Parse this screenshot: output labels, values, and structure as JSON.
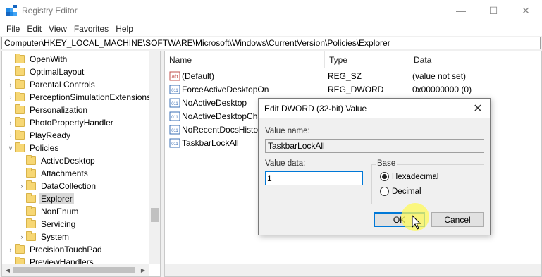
{
  "window": {
    "title": "Registry Editor"
  },
  "menu": [
    "File",
    "Edit",
    "View",
    "Favorites",
    "Help"
  ],
  "address": "Computer\\HKEY_LOCAL_MACHINE\\SOFTWARE\\Microsoft\\Windows\\CurrentVersion\\Policies\\Explorer",
  "tree": {
    "items": [
      {
        "label": "OpenWith",
        "expandable": false,
        "level": 0
      },
      {
        "label": "OptimalLayout",
        "expandable": false,
        "level": 0
      },
      {
        "label": "Parental Controls",
        "expandable": true,
        "level": 0
      },
      {
        "label": "PerceptionSimulationExtensions",
        "expandable": true,
        "level": 0
      },
      {
        "label": "Personalization",
        "expandable": false,
        "level": 0
      },
      {
        "label": "PhotoPropertyHandler",
        "expandable": true,
        "level": 0
      },
      {
        "label": "PlayReady",
        "expandable": true,
        "level": 0
      },
      {
        "label": "Policies",
        "expandable": true,
        "expanded": true,
        "level": 0
      },
      {
        "label": "ActiveDesktop",
        "expandable": false,
        "level": 1
      },
      {
        "label": "Attachments",
        "expandable": false,
        "level": 1
      },
      {
        "label": "DataCollection",
        "expandable": true,
        "level": 1
      },
      {
        "label": "Explorer",
        "expandable": false,
        "level": 1,
        "selected": true
      },
      {
        "label": "NonEnum",
        "expandable": false,
        "level": 1
      },
      {
        "label": "Servicing",
        "expandable": false,
        "level": 1
      },
      {
        "label": "System",
        "expandable": true,
        "level": 1
      },
      {
        "label": "PrecisionTouchPad",
        "expandable": true,
        "level": 0
      },
      {
        "label": "PreviewHandlers",
        "expandable": false,
        "level": 0
      }
    ]
  },
  "list": {
    "columns": [
      "Name",
      "Type",
      "Data"
    ],
    "rows": [
      {
        "icon": "string-value-icon",
        "name": "(Default)",
        "type": "REG_SZ",
        "data": "(value not set)"
      },
      {
        "icon": "dword-value-icon",
        "name": "ForceActiveDesktopOn",
        "type": "REG_DWORD",
        "data": "0x00000000 (0)"
      },
      {
        "icon": "dword-value-icon",
        "name": "NoActiveDesktop",
        "type": "",
        "data": ""
      },
      {
        "icon": "dword-value-icon",
        "name": "NoActiveDesktopCha",
        "type": "",
        "data": ""
      },
      {
        "icon": "dword-value-icon",
        "name": "NoRecentDocsHistor",
        "type": "",
        "data": ""
      },
      {
        "icon": "dword-value-icon",
        "name": "TaskbarLockAll",
        "type": "",
        "data": ""
      }
    ]
  },
  "dialog": {
    "title": "Edit DWORD (32-bit) Value",
    "value_name_label": "Value name:",
    "value_name": "TaskbarLockAll",
    "value_data_label": "Value data:",
    "value_data": "1",
    "base_label": "Base",
    "hex_label": "Hexadecimal",
    "dec_label": "Decimal",
    "ok_label": "OK",
    "cancel_label": "Cancel",
    "selected_base": "Hexadecimal"
  }
}
